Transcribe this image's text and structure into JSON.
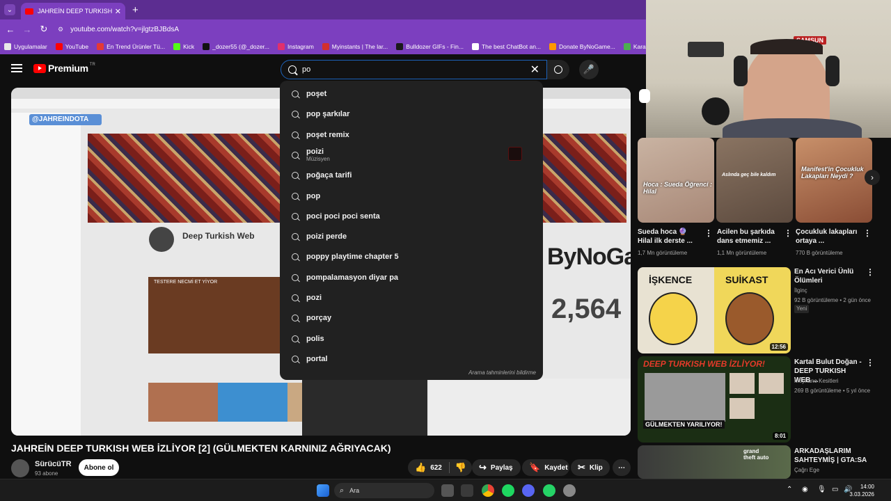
{
  "browser": {
    "tab_title": "JAHREİN DEEP TURKISH WEB İZ",
    "url": "youtube.com/watch?v=jlgtzBJBdsA",
    "bookmarks": [
      {
        "label": "Uygulamalar",
        "color": "#e8e8e8"
      },
      {
        "label": "YouTube",
        "color": "#ff0000"
      },
      {
        "label": "En Trend Ürünler Tü...",
        "color": "#e53935"
      },
      {
        "label": "Kick",
        "color": "#53fc18"
      },
      {
        "label": "_dozer55 (@_dozer...",
        "color": "#111111"
      },
      {
        "label": "Instagram",
        "color": "#e1306c"
      },
      {
        "label": "Myinstants | The lar...",
        "color": "#d32f2f"
      },
      {
        "label": "Bulldozer GIFs - Fin...",
        "color": "#1a1a1a"
      },
      {
        "label": "The best ChatBot an...",
        "color": "#ffffff"
      },
      {
        "label": "Donate ByNoGame...",
        "color": "#ff9800"
      },
      {
        "label": "Karatay Belediyes",
        "color": "#4caf50"
      }
    ]
  },
  "youtube": {
    "logo_text": "Premium",
    "logo_region": "TR",
    "search_value": "po",
    "suggestions": [
      {
        "text": "poşet"
      },
      {
        "text": "pop şarkılar"
      },
      {
        "text": "poşet remix"
      },
      {
        "text": "poizi",
        "sub": "Müzisyen"
      },
      {
        "text": "poğaça tarifi"
      },
      {
        "text": "pop"
      },
      {
        "text": "poci poci poci senta"
      },
      {
        "text": "poizi perde"
      },
      {
        "text": "poppy playtime chapter 5"
      },
      {
        "text": "pompalamasyon diyar pa"
      },
      {
        "text": "pozi"
      },
      {
        "text": "porçay"
      },
      {
        "text": "polis"
      },
      {
        "text": "portal"
      }
    ],
    "report_predictions": "Arama tahminlerini bildirme"
  },
  "player_content": {
    "overlay_tag": "@JAHREINDOTA",
    "channel_name": "Deep Turkish Web",
    "video_label": "TESTERE NECMİ ET YİYOR",
    "brand_logo": "ByNoGame.com",
    "counter": "2,564"
  },
  "video": {
    "title": "JAHREİN DEEP TURKISH WEB İZLİYOR [2] (GÜLMEKTEN KARNINIZ AĞRIYACAK)",
    "channel": "SürücüTR",
    "subscribers": "93 abone",
    "subscribe_label": "Abone ol",
    "likes": "622",
    "share_label": "Paylaş",
    "save_label": "Kaydet",
    "clip_label": "Klip"
  },
  "shorts": [
    {
      "title": "Sueda hoca 🔮 Hilal ilk derste ...",
      "views": "1,7 Mn görüntüleme",
      "thumb_text": "Hoca : Sueda Öğrenci : Hilal"
    },
    {
      "title": "Acilen bu şarkıda dans etmemiz ...",
      "views": "1,1 Mn görüntüleme",
      "thumb_text": "Aslında geç bile kaldım"
    },
    {
      "title": "Çocukluk lakapları ortaya ...",
      "views": "770 B görüntüleme",
      "thumb_text": "Manifest'in Çocukluk Lakapları Neydi ?"
    }
  ],
  "related": [
    {
      "title": "En Acı Verici Ünlü Ölümleri",
      "channel": "İlginç",
      "meta": "92 B görüntüleme • 2 gün önce",
      "badge": "Yeni",
      "duration": "12:56",
      "thumb_left": "İŞKENCE",
      "thumb_right": "SUİKAST"
    },
    {
      "title": "Kartal Bulut Doğan - DEEP TURKISH WEB ...",
      "channel": "Meyhane Kesitleri",
      "meta": "269 B görüntüleme • 5 yıl önce",
      "duration": "8:01",
      "thumb_top": "DEEP TURKISH WEB İZLİYOR!",
      "thumb_bottom": "GÜLMEKTEN YARILIYOR!"
    },
    {
      "title": "ARKADAŞLARIM SAHTEYMİŞ | GTA:SA",
      "channel": "Çağrı Ege",
      "thumb_text": "grand theft auto"
    }
  ],
  "webcam": {
    "sign": "SAMSUN"
  },
  "taskbar": {
    "search_label": "Ara",
    "time": "14:00",
    "date": "3.03.2026"
  }
}
